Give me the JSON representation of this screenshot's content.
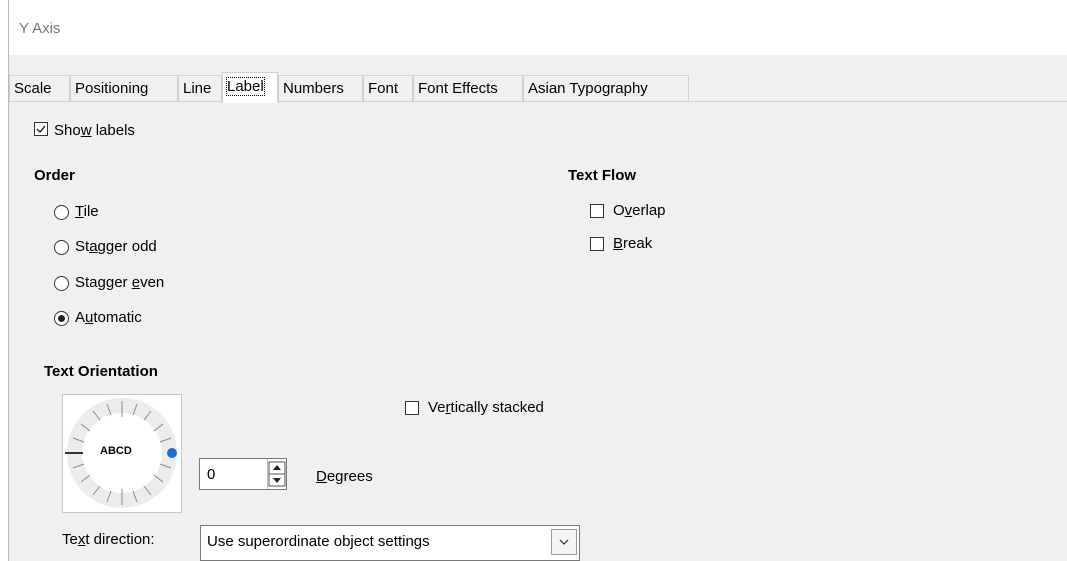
{
  "window": {
    "title": "Y Axis"
  },
  "tabs": [
    {
      "label": "Scale"
    },
    {
      "label": "Positioning"
    },
    {
      "label": "Line"
    },
    {
      "label": "Label",
      "active": true
    },
    {
      "label": "Numbers"
    },
    {
      "label": "Font"
    },
    {
      "label": "Font Effects"
    },
    {
      "label": "Asian Typography"
    }
  ],
  "show_labels": {
    "pre": "Sho",
    "u": "w",
    "post": " labels",
    "checked": true
  },
  "order": {
    "heading": "Order",
    "options": [
      {
        "pre": "",
        "u": "T",
        "post": "ile",
        "selected": false
      },
      {
        "pre": "St",
        "u": "a",
        "post": "gger odd",
        "selected": false
      },
      {
        "pre": "Stagger ",
        "u": "e",
        "post": "ven",
        "selected": false
      },
      {
        "pre": "A",
        "u": "u",
        "post": "tomatic",
        "selected": true
      }
    ]
  },
  "text_flow": {
    "heading": "Text Flow",
    "overlap": {
      "pre": "O",
      "u": "v",
      "post": "erlap",
      "checked": false
    },
    "break": {
      "pre": "",
      "u": "B",
      "post": "reak",
      "checked": false
    }
  },
  "text_orientation": {
    "heading": "Text Orientation",
    "dial_text": "ABCD",
    "vertically_stacked": {
      "pre": "Ve",
      "u": "r",
      "post": "tically stacked",
      "checked": false
    },
    "degrees_value": "0",
    "degrees_label": {
      "pre": "",
      "u": "D",
      "post": "egrees"
    }
  },
  "text_direction": {
    "label": {
      "pre": "Te",
      "u": "x",
      "post": "t direction:"
    },
    "value": "Use superordinate object settings"
  },
  "colors": {
    "accent": "#1e6fd0",
    "dialog_bg": "#f0f0f0"
  }
}
